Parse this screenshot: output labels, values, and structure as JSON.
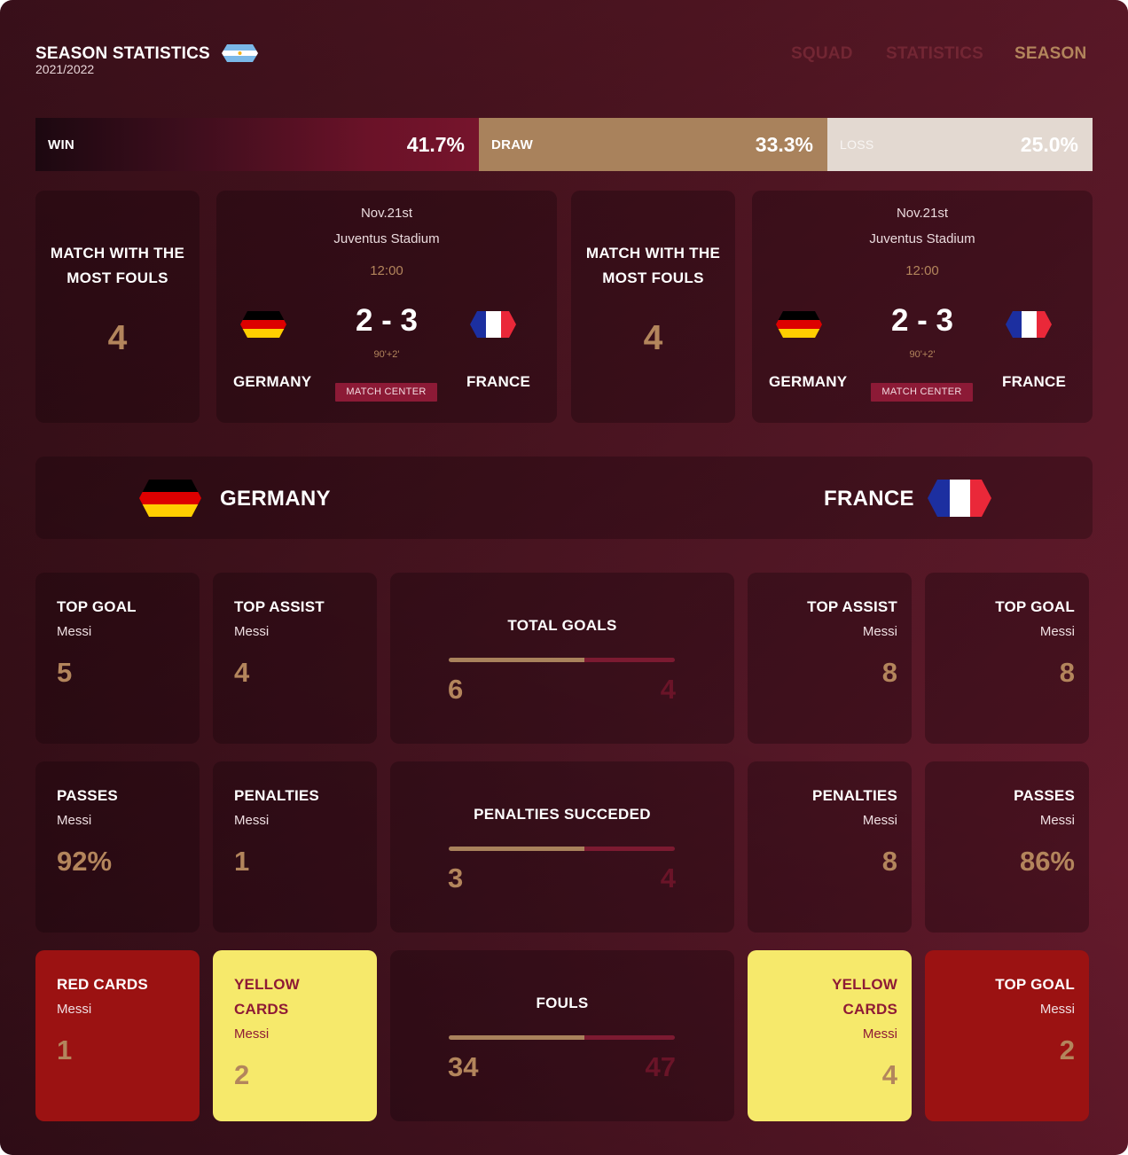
{
  "header": {
    "title": "SEASON STATISTICS",
    "season": "2021/2022",
    "nav": [
      {
        "label": "SQUAD",
        "active": false
      },
      {
        "label": "STATISTICS",
        "active": false
      },
      {
        "label": "SEASON",
        "active": true
      }
    ]
  },
  "results": {
    "win": {
      "label": "WIN",
      "pct": "41.7%",
      "value": 41.7
    },
    "draw": {
      "label": "DRAW",
      "pct": "33.3%",
      "value": 33.3
    },
    "loss": {
      "label": "LOSS",
      "pct": "25.0%",
      "value": 25.0
    }
  },
  "fouls_cards": [
    {
      "title_line1": "MATCH WITH THE",
      "title_line2": "MOST FOULS",
      "value": "4"
    },
    {
      "title_line1": "MATCH WITH THE",
      "title_line2": "MOST FOULS",
      "value": "4"
    }
  ],
  "matches": [
    {
      "date": "Nov.21st",
      "stadium": "Juventus Stadium",
      "time": "12:00",
      "score": "2 - 3",
      "extra": "90'+2'",
      "home": "GERMANY",
      "away": "FRANCE",
      "button": "MATCH CENTER"
    },
    {
      "date": "Nov.21st",
      "stadium": "Juventus Stadium",
      "time": "12:00",
      "score": "2 - 3",
      "extra": "90'+2'",
      "home": "GERMANY",
      "away": "FRANCE",
      "button": "MATCH CENTER"
    }
  ],
  "banner": {
    "home": "GERMANY",
    "away": "FRANCE"
  },
  "stats": {
    "row1": {
      "left": [
        {
          "title": "TOP GOAL",
          "player": "Messi",
          "value": "5"
        },
        {
          "title": "TOP ASSIST",
          "player": "Messi",
          "value": "4"
        }
      ],
      "compare": {
        "title": "TOTAL GOALS",
        "left": "6",
        "right": "4",
        "left_share": 0.6
      },
      "right": [
        {
          "title": "TOP ASSIST",
          "player": "Messi",
          "value": "8"
        },
        {
          "title": "TOP GOAL",
          "player": "Messi",
          "value": "8"
        }
      ]
    },
    "row2": {
      "left": [
        {
          "title": "PASSES",
          "player": "Messi",
          "value": "92%"
        },
        {
          "title": "PENALTIES",
          "player": "Messi",
          "value": "1"
        }
      ],
      "compare": {
        "title": "PENALTIES SUCCEDED",
        "left": "3",
        "right": "4",
        "left_share": 0.6
      },
      "right": [
        {
          "title": "PENALTIES",
          "player": "Messi",
          "value": "8"
        },
        {
          "title": "PASSES",
          "player": "Messi",
          "value": "86%"
        }
      ]
    },
    "row3": {
      "left": [
        {
          "title": "RED CARDS",
          "player": "Messi",
          "value": "1"
        },
        {
          "title_line1": "YELLOW",
          "title_line2": "CARDS",
          "player": "Messi",
          "value": "2"
        }
      ],
      "compare": {
        "title": "FOULS",
        "left": "34",
        "right": "47",
        "left_share": 0.6
      },
      "right": [
        {
          "title_line1": "YELLOW",
          "title_line2": "CARDS",
          "player": "Messi",
          "value": "4"
        },
        {
          "title": "TOP GOAL",
          "player": "Messi",
          "value": "2"
        }
      ]
    }
  },
  "colors": {
    "accent_gold": "#b3855c",
    "draw": "#a9825c",
    "loss": "#e3d9d1",
    "red_card": "#9b1212",
    "yellow_card": "#f6e96b",
    "button": "#8c1a36"
  },
  "icons": {
    "argentina_flag": "argentina-flag-icon",
    "germany_flag": "germany-flag-icon",
    "france_flag": "france-flag-icon"
  }
}
